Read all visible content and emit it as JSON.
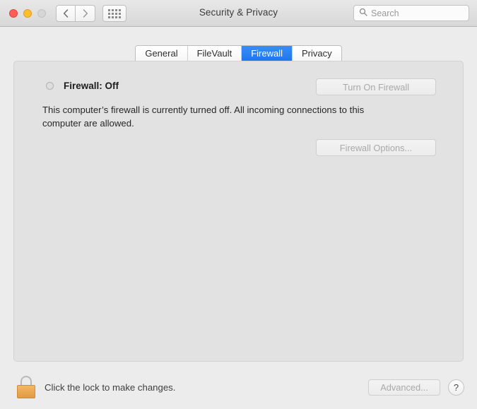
{
  "window": {
    "title": "Security & Privacy",
    "traffic_lights": [
      {
        "name": "close",
        "color": "#ff5f57"
      },
      {
        "name": "minimize",
        "color": "#ffbd2e"
      },
      {
        "name": "zoom",
        "color": "#d6d6d6"
      }
    ],
    "nav": {
      "back_icon": "chevron-left-icon",
      "forward_icon": "chevron-right-icon"
    },
    "show_all_icon": "grid-icon"
  },
  "search": {
    "icon": "search-icon",
    "placeholder": "Search",
    "value": ""
  },
  "tabs": [
    {
      "label": "General",
      "selected": false
    },
    {
      "label": "FileVault",
      "selected": false
    },
    {
      "label": "Firewall",
      "selected": true
    },
    {
      "label": "Privacy",
      "selected": false
    }
  ],
  "firewall": {
    "status_indicator": "status-off-indicator",
    "status_label": "Firewall: Off",
    "description": "This computer’s firewall is currently turned off. All incoming connections to this computer are allowed.",
    "turn_on_label": "Turn On Firewall",
    "options_label": "Firewall Options...",
    "turn_on_enabled": false,
    "options_enabled": false
  },
  "footer": {
    "lock_icon": "lock-closed-icon",
    "lock_text": "Click the lock to make changes.",
    "advanced_label": "Advanced...",
    "advanced_enabled": false,
    "help_label": "?"
  },
  "colors": {
    "accent": "#1a76ee",
    "window_background": "#ececec",
    "panel_background": "#e2e2e2",
    "disabled_text": "#a9a9a9",
    "lock_body": "#e09a42"
  }
}
